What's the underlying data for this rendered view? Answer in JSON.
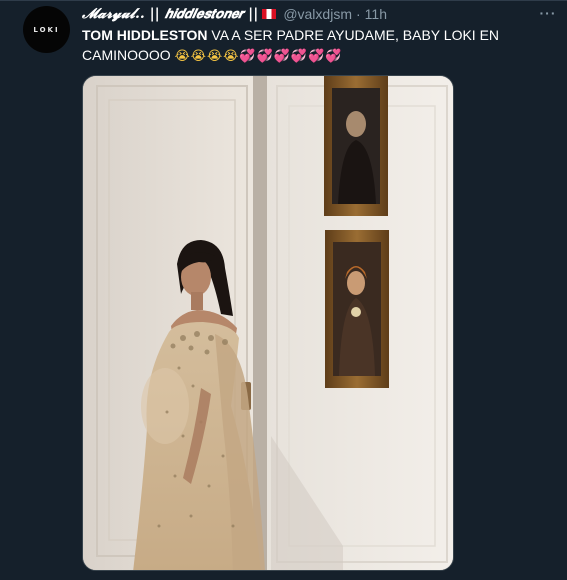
{
  "tweet": {
    "display_name": "𝓜𝓪𝓻𝔂𝓾𝓵.. || 𝙝𝙞𝙙𝙙𝙡𝙚𝙨𝙩𝙤𝙣𝙚𝙧 ||",
    "flag_icon": "peru-flag-icon",
    "handle": "@valxdjsm",
    "separator": "·",
    "time": "11h",
    "more_icon": "more-options-icon",
    "text_bold": "TOM HIDDLESTON",
    "text_rest": " VA A SER PADRE AYUDAME, BABY LOKI EN CAMINOOOO ",
    "emoji_cry": "😭😭😭😭",
    "emoji_hearts": "💞💞💞💞💞💞"
  },
  "avatar": {
    "label": "LOKI",
    "background": "#050505"
  },
  "media": {
    "alt_icon": "photo-image",
    "description_colors": {
      "wall": "#ece6de",
      "dress": "#c9b08e",
      "frame": "#7a5427"
    }
  },
  "colors": {
    "background": "#15202b",
    "text_primary": "#ffffff",
    "text_secondary": "#8899a6",
    "border": "#38444d"
  }
}
